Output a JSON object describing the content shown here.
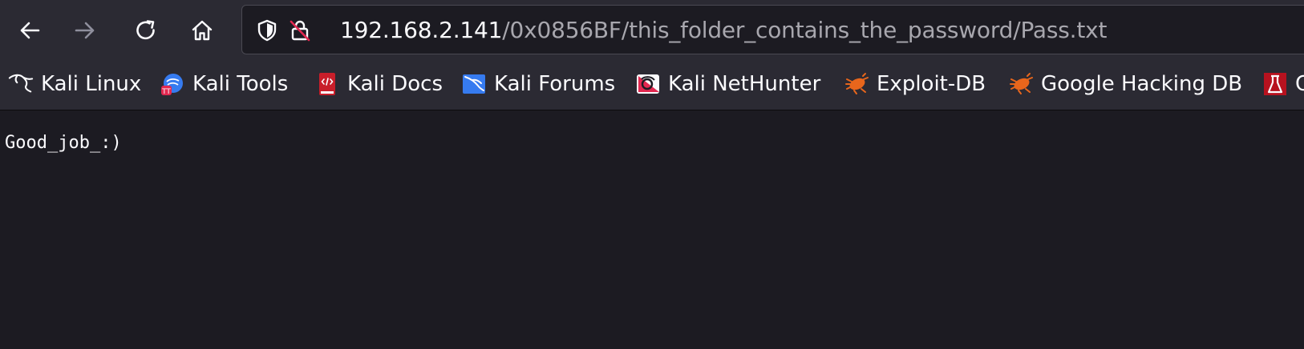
{
  "navigation": {
    "back": "back",
    "forward": "forward",
    "reload": "reload",
    "home": "home"
  },
  "url_bar": {
    "host": "192.168.2.141",
    "path": "/0x0856BF/this_folder_contains_the_password/Pass.txt"
  },
  "bookmarks": [
    {
      "label": "Kali Linux",
      "icon": "kali-dragon-icon"
    },
    {
      "label": "Kali Tools",
      "icon": "kali-tools-icon"
    },
    {
      "label": "Kali Docs",
      "icon": "kali-docs-icon"
    },
    {
      "label": "Kali Forums",
      "icon": "kali-forums-icon"
    },
    {
      "label": "Kali NetHunter",
      "icon": "kali-nethunter-icon"
    },
    {
      "label": "Exploit-DB",
      "icon": "exploit-db-icon"
    },
    {
      "label": "Google Hacking DB",
      "icon": "google-hacking-db-icon"
    },
    {
      "label": "C",
      "icon": "offsec-icon"
    }
  ],
  "page": {
    "text": "Good_job_:)"
  },
  "colors": {
    "toolbar_bg": "#2b2a33",
    "content_bg": "#1c1b22",
    "text": "#fbfbfe",
    "url_path": "#a8a7ae",
    "disabled_icon": "#8f8f9d",
    "exploit_orange": "#e8661c",
    "kali_blue": "#367bf0",
    "offsec_red": "#b7121f"
  }
}
